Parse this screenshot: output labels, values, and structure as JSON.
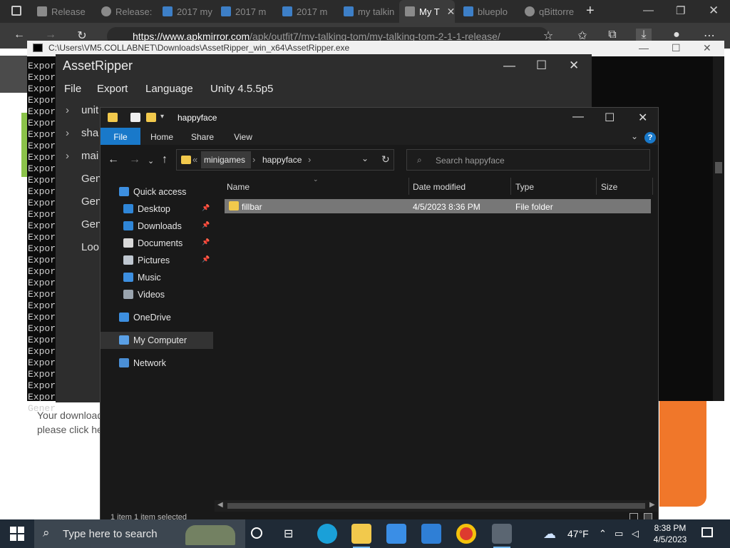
{
  "browser": {
    "tabs": [
      {
        "label": "Release",
        "icon": "page-icon"
      },
      {
        "label": "Release:",
        "icon": "github-icon"
      },
      {
        "label": "2017 my",
        "icon": "search-icon"
      },
      {
        "label": "2017 m",
        "icon": "search-icon"
      },
      {
        "label": "2017 m",
        "icon": "search-icon"
      },
      {
        "label": "my talkin",
        "icon": "search-icon"
      },
      {
        "label": "My T",
        "icon": "page-icon"
      },
      {
        "label": "blueplo",
        "icon": "search-icon"
      },
      {
        "label": "qBittorre",
        "icon": "github-icon"
      }
    ],
    "new_tab_label": "+",
    "address": {
      "host": "https://www.apkmirror.com",
      "path": "/apk/outfit7/my-talking-tom/my-talking-tom-2-1-1-release/"
    }
  },
  "webpage": {
    "download_text_1": "Your download",
    "download_text_2": "please click he"
  },
  "console": {
    "title": "C:\\Users\\VM5.COLLABNET\\Downloads\\AssetRipper_win_x64\\AssetRipper.exe",
    "line_text": "Expor",
    "last_line": "Gener",
    "line_count": 31
  },
  "assetripper": {
    "title": "AssetRipper",
    "menu": [
      "File",
      "Export",
      "Language",
      "Unity 4.5.5p5"
    ],
    "tree": [
      {
        "label": "unit",
        "chevron": true
      },
      {
        "label": "sha",
        "chevron": true
      },
      {
        "label": "mai",
        "chevron": true
      },
      {
        "label": "Gen",
        "chevron": false
      },
      {
        "label": "Gen",
        "chevron": false
      },
      {
        "label": "Gen",
        "chevron": false
      },
      {
        "label": "Loo",
        "chevron": false
      }
    ]
  },
  "explorer": {
    "title": "happyface",
    "ribbon_tabs": [
      "File",
      "Home",
      "Share",
      "View"
    ],
    "help_label": "?",
    "breadcrumb": {
      "overflow": "«",
      "segments": [
        "minigames",
        "happyface"
      ]
    },
    "search_placeholder": "Search happyface",
    "nav_pane": [
      {
        "label": "Quick access",
        "icon": "star-icon",
        "pinned": false
      },
      {
        "label": "Desktop",
        "icon": "desktop-icon",
        "pinned": true
      },
      {
        "label": "Downloads",
        "icon": "download-icon",
        "pinned": true
      },
      {
        "label": "Documents",
        "icon": "document-icon",
        "pinned": true
      },
      {
        "label": "Pictures",
        "icon": "picture-icon",
        "pinned": true
      },
      {
        "label": "Music",
        "icon": "music-icon",
        "pinned": false
      },
      {
        "label": "Videos",
        "icon": "video-icon",
        "pinned": false
      },
      {
        "label": "OneDrive",
        "icon": "cloud-icon",
        "pinned": false
      },
      {
        "label": "My Computer",
        "icon": "computer-icon",
        "pinned": false
      },
      {
        "label": "Network",
        "icon": "network-icon",
        "pinned": false
      }
    ],
    "columns": [
      "Name",
      "Date modified",
      "Type",
      "Size"
    ],
    "rows": [
      {
        "name": "fillbar",
        "date": "4/5/2023 8:36 PM",
        "type": "File folder",
        "size": ""
      }
    ],
    "status": "1 item  1 item selected"
  },
  "taskbar": {
    "search_placeholder": "Type here to search",
    "weather": "47°F",
    "time": "8:38 PM",
    "date": "4/5/2023",
    "colors": {
      "bar": "#1f2a36",
      "accent": "#1979ca"
    }
  }
}
